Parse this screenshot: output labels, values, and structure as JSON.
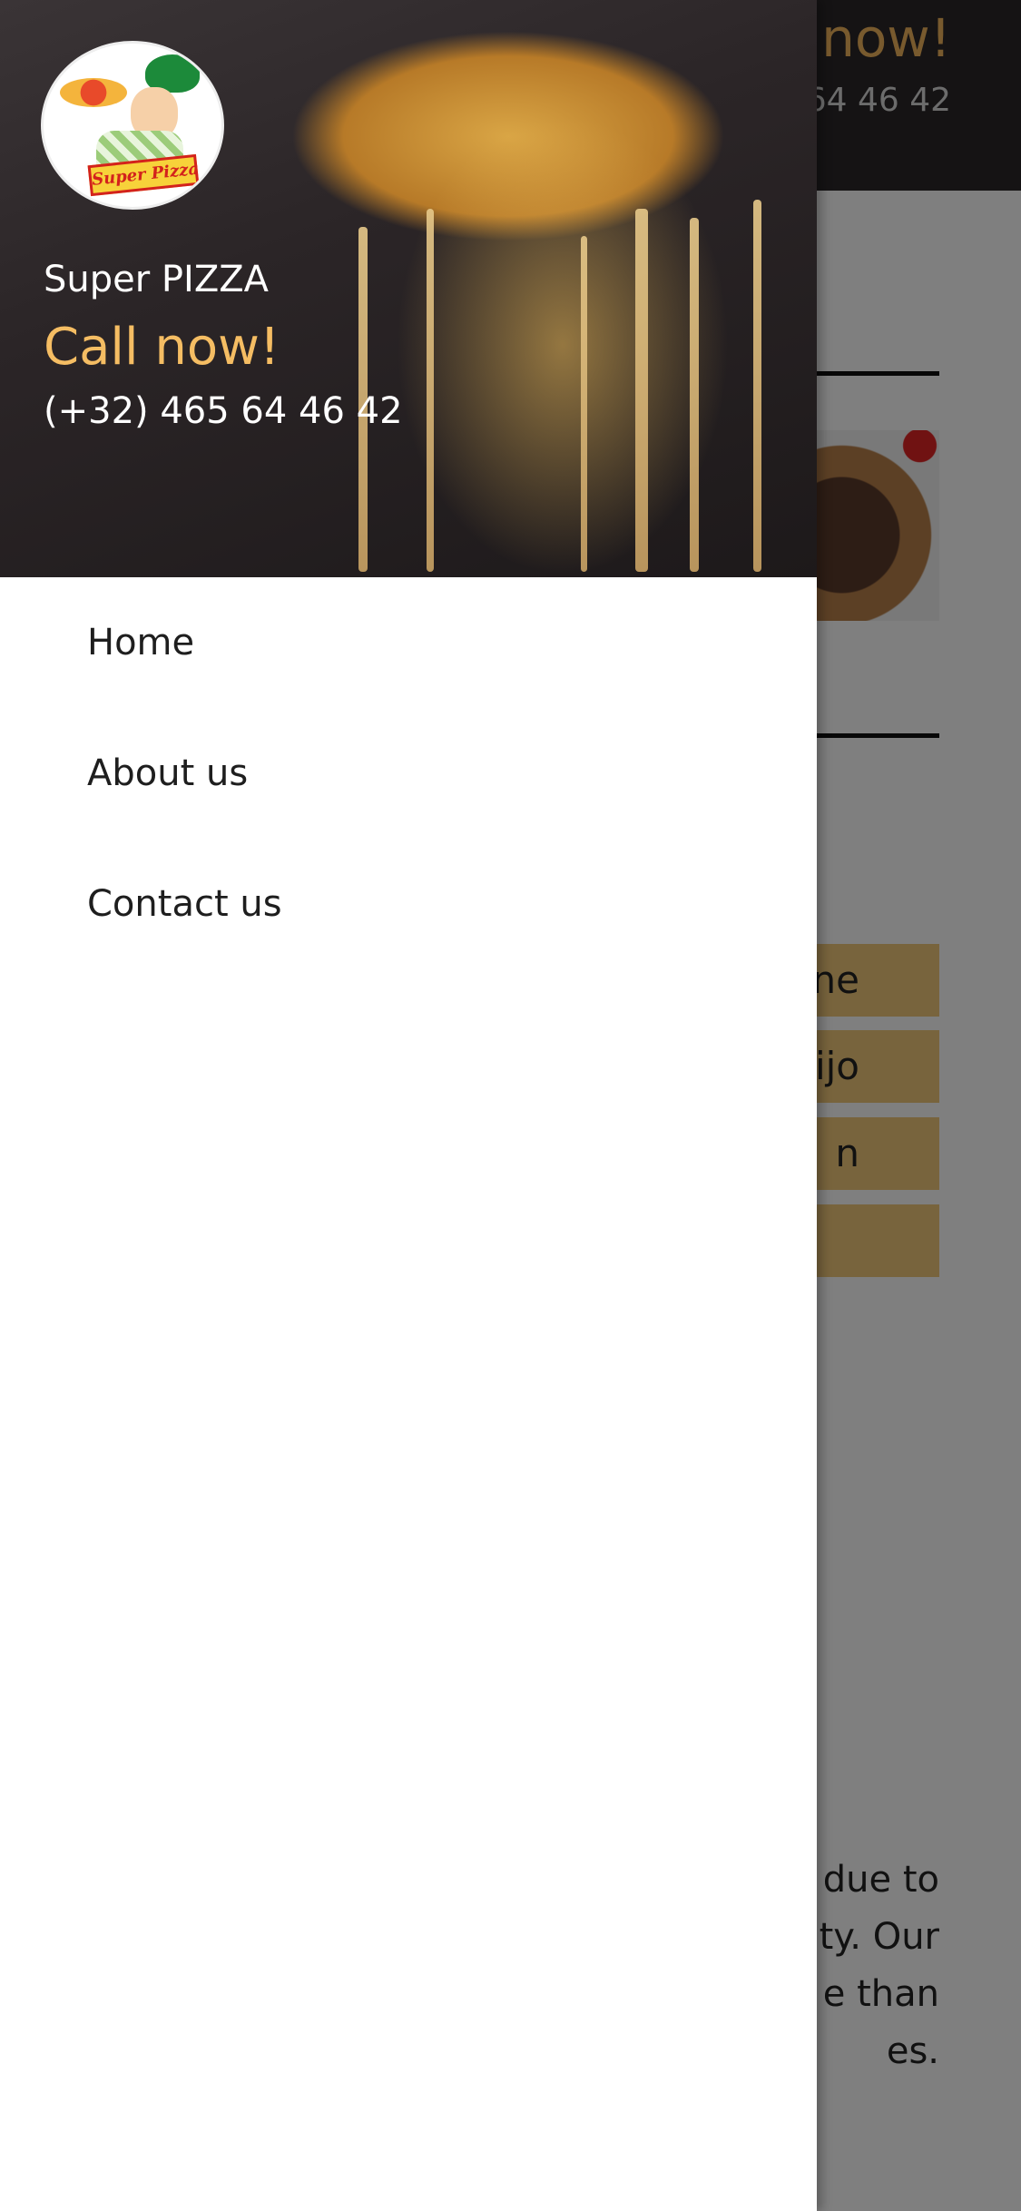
{
  "page": {
    "call_now_partial": "l now!",
    "phone_partial": "64 46 42",
    "menu_chips": [
      "ne",
      "Queijo",
      "n",
      ""
    ],
    "paragraph_lines": [
      "due to",
      "ty. Our",
      "e than",
      "es."
    ]
  },
  "drawer": {
    "logo_text": "Super Pizza",
    "brand": "Super PIZZA",
    "call_now": "Call now!",
    "phone": "(+32) 465 64 46 42",
    "nav": [
      {
        "label": "Home"
      },
      {
        "label": "About us"
      },
      {
        "label": "Contact us"
      }
    ]
  },
  "colors": {
    "accent": "#f5bd63",
    "chip": "#f0c87a",
    "header_dark": "#2a2628",
    "scrim": "rgba(0,0,0,0.5)"
  }
}
